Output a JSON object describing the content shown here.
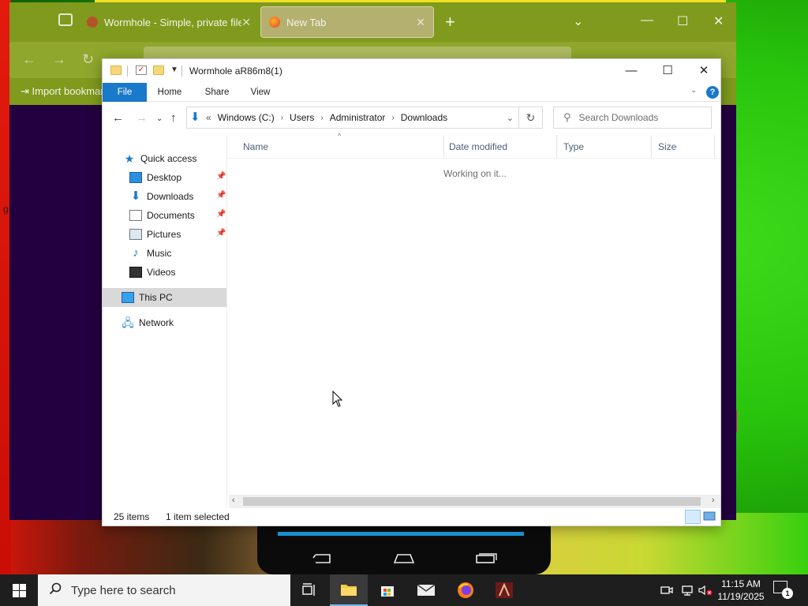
{
  "firefox": {
    "tabs": [
      {
        "label": "Wormhole - Simple, private file",
        "active": false
      },
      {
        "label": "New Tab",
        "active": true
      }
    ],
    "bookmark_item": "Import bookmar",
    "new_tab_glyph": "+",
    "side_char": "g"
  },
  "explorer": {
    "title": "Wormhole aR86m8(1)",
    "ribbon_tabs": [
      "File",
      "Home",
      "Share",
      "View"
    ],
    "breadcrumb": [
      "Windows (C:)",
      "Users",
      "Administrator",
      "Downloads"
    ],
    "breadcrumb_prefix": "«",
    "search_placeholder": "Search Downloads",
    "nav_items": [
      {
        "label": "Quick access",
        "icon": "star-icon",
        "pinned": false
      },
      {
        "label": "Desktop",
        "icon": "desktop-icon",
        "pinned": true
      },
      {
        "label": "Downloads",
        "icon": "download-icon",
        "pinned": true
      },
      {
        "label": "Documents",
        "icon": "document-icon",
        "pinned": true
      },
      {
        "label": "Pictures",
        "icon": "pictures-icon",
        "pinned": true
      },
      {
        "label": "Music",
        "icon": "music-icon",
        "pinned": false
      },
      {
        "label": "Videos",
        "icon": "video-icon",
        "pinned": false
      },
      {
        "label": "This PC",
        "icon": "this-pc-icon",
        "selected": true
      },
      {
        "label": "Network",
        "icon": "network-icon"
      }
    ],
    "columns": [
      "Name",
      "Date modified",
      "Type",
      "Size"
    ],
    "working_text": "Working on it...",
    "status": {
      "items": "25 items",
      "selected": "1 item selected"
    },
    "accent": "#1979ca"
  },
  "taskbar": {
    "search_placeholder": "Type here to search",
    "time": "11:15 AM",
    "date": "11/19/2025",
    "notification_count": "1"
  }
}
